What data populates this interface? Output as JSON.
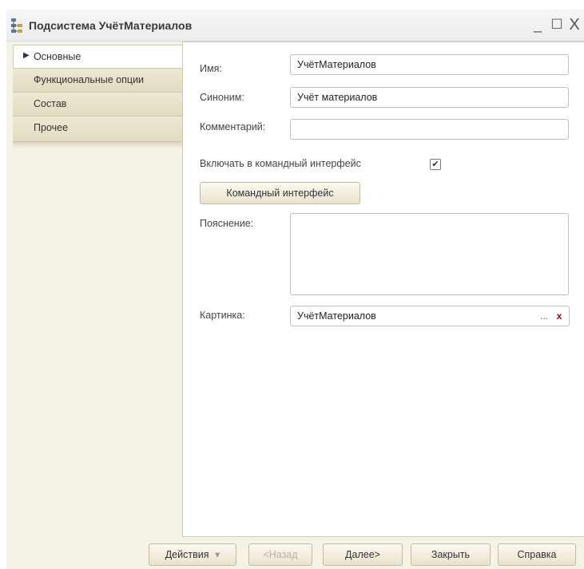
{
  "window": {
    "title": "Подсистема УчётМатериалов",
    "icon": "subsystem-tree-icon",
    "controls": {
      "minimize": "_",
      "maximize": "☐",
      "close": "X"
    }
  },
  "tabs": [
    {
      "label": "Основные",
      "active": true
    },
    {
      "label": "Функциональные опции",
      "active": false
    },
    {
      "label": "Состав",
      "active": false
    },
    {
      "label": "Прочее",
      "active": false
    }
  ],
  "form": {
    "name_label": "Имя:",
    "name_value": "УчётМатериалов",
    "synonym_label": "Синоним:",
    "synonym_value": "Учёт материалов",
    "comment_label": "Комментарий:",
    "comment_value": "",
    "include_label": "Включать в командный интерфейс",
    "include_checked": true,
    "include_mark": "✔",
    "command_interface_button": "Командный интерфейс",
    "explanation_label": "Пояснение:",
    "explanation_value": "",
    "picture_label": "Картинка:",
    "picture_value": "УчётМатериалов",
    "picture_select": "...",
    "picture_clear": "x"
  },
  "footer": {
    "actions": "Действия",
    "actions_arrow": "▾",
    "back": "<Назад",
    "next": "Далее>",
    "close": "Закрыть",
    "help": "Справка"
  },
  "colors": {
    "frame_bg": "#f5f2e6",
    "tab_bg": "#e6dfc7",
    "clear_icon": "#b30000"
  }
}
